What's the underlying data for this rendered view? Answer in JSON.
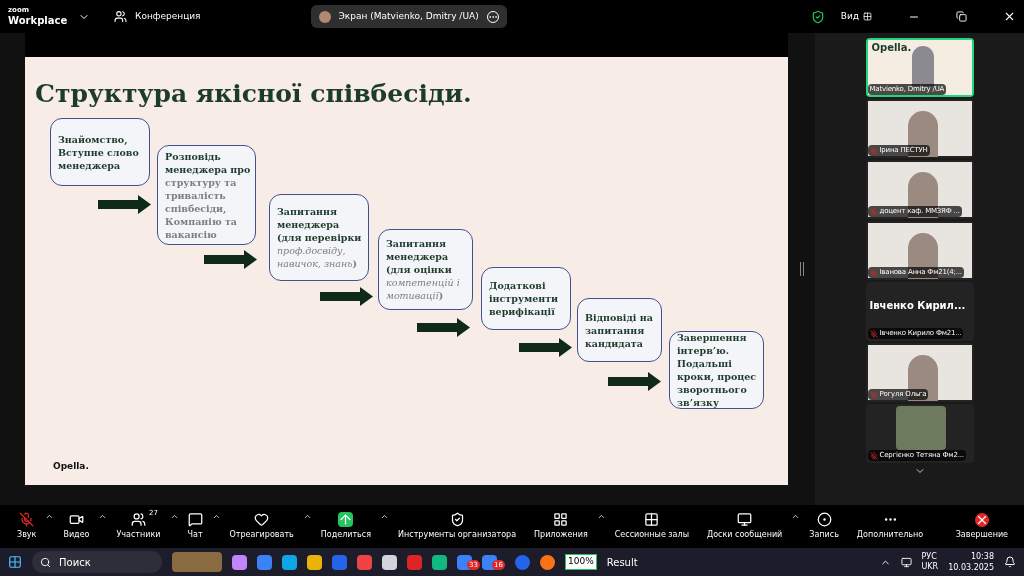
{
  "title_bar": {
    "brand_top": "zoom",
    "brand": "Workplace",
    "meeting": "Конференция",
    "share_label": "Экран (Matvienko, Dmitry /UA)",
    "view": "Вид"
  },
  "slide": {
    "title": "Структура якісної співбесіди.",
    "footer": "Opella.",
    "steps": [
      {
        "text": "**Знайомство, Вступне слово менеджера**"
      },
      {
        "text": "**Розповідь менеджера про** структуру та тривалість співбесіди, Компанію та вакансію"
      },
      {
        "text": "**Запитання менеджера (для перевірки** *проф.досвіду, навичок, знань*)"
      },
      {
        "text": "**Запитання менеджера (для оцінки** *компетенцій і мотивації*)"
      },
      {
        "text": "**Додаткові інструменти верифікації**"
      },
      {
        "text": "**Відповіді на запитання кандидата**"
      },
      {
        "text": "**Завершення інтерв’ю. Подальші кроки, процес зворотнього зв’язку**"
      }
    ]
  },
  "participants": [
    {
      "kind": "slide",
      "name": "Matvienko, Dmitry /UA",
      "logo": "Opella.",
      "selected": true,
      "muted": false
    },
    {
      "kind": "video",
      "name": "Ірина ПЕСТУН",
      "selected": false,
      "muted": true
    },
    {
      "kind": "video",
      "name": "доцент каф. ММЗЯФ ...",
      "selected": false,
      "muted": true
    },
    {
      "kind": "video",
      "name": "Іванова Анна Фм21(4;...",
      "selected": false,
      "muted": true
    },
    {
      "kind": "name",
      "name": "Івченко Кирило Фм21...",
      "display": "Івченко  Кирил...",
      "selected": false,
      "muted": true
    },
    {
      "kind": "video",
      "name": "Рогуля Ольга",
      "selected": false,
      "muted": true
    },
    {
      "kind": "small",
      "name": "Сергієнко Тетяна Фм2...",
      "selected": false,
      "muted": true
    }
  ],
  "toolbar": [
    {
      "kind": "mic",
      "label": "Звук",
      "caret": true
    },
    {
      "kind": "video",
      "label": "Видео",
      "caret": true
    },
    {
      "kind": "people",
      "label": "Участники",
      "count": "27",
      "caret": true
    },
    {
      "kind": "chat",
      "label": "Чат",
      "caret": true
    },
    {
      "kind": "heart",
      "label": "Отреагировать",
      "caret": true
    },
    {
      "kind": "share",
      "label": "Поделиться",
      "caret": true
    },
    {
      "kind": "shield",
      "label": "Инструменты организатора",
      "caret": false
    },
    {
      "kind": "apps",
      "label": "Приложения",
      "caret": true
    },
    {
      "kind": "rooms",
      "label": "Сессионные залы",
      "caret": false
    },
    {
      "kind": "board",
      "label": "Доски сообщений",
      "caret": true
    },
    {
      "kind": "record",
      "label": "Запись",
      "caret": false
    },
    {
      "kind": "more",
      "label": "Дополнительно",
      "caret": false
    }
  ],
  "end_button": "Завершение",
  "taskbar": {
    "search": "Поиск",
    "badges": [
      "33",
      "16"
    ],
    "battery": "100%",
    "app": "Result",
    "lang": "РУС",
    "layout": "UKR",
    "time": "10:38",
    "date": "10.03.2025"
  }
}
